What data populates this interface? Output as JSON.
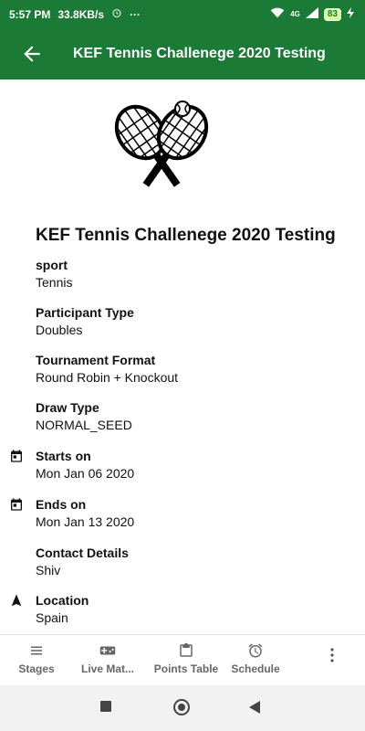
{
  "status": {
    "time": "5:57 PM",
    "speed": "33.8KB/s",
    "dots": "···",
    "signal": "4G",
    "battery": "83"
  },
  "appbar": {
    "title": "KEF Tennis Challenege 2020 Testing"
  },
  "tournament": {
    "name": "KEF Tennis Challenege 2020 Testing",
    "fields": [
      {
        "label": "sport",
        "value": "Tennis"
      },
      {
        "label": "Participant Type",
        "value": "Doubles"
      },
      {
        "label": "Tournament Format",
        "value": "Round Robin + Knockout"
      },
      {
        "label": "Draw Type",
        "value": "NORMAL_SEED"
      },
      {
        "label": "Starts on",
        "value": "Mon Jan 06 2020"
      },
      {
        "label": "Ends on",
        "value": "Mon Jan 13 2020"
      },
      {
        "label": "Contact Details",
        "value": "Shiv"
      },
      {
        "label": "Location",
        "value": "Spain"
      }
    ]
  },
  "bottom_nav": {
    "items": [
      {
        "label": "Stages",
        "icon": "menu-icon"
      },
      {
        "label": "Live Mat...",
        "icon": "gamepad-icon"
      },
      {
        "label": "Points Table",
        "icon": "clipboard-icon"
      },
      {
        "label": "Schedule",
        "icon": "alarm-icon"
      }
    ],
    "more_icon": "more-vertical-icon"
  },
  "colors": {
    "primary": "#1b7a36",
    "text": "#111111",
    "nav_text": "#666666"
  }
}
